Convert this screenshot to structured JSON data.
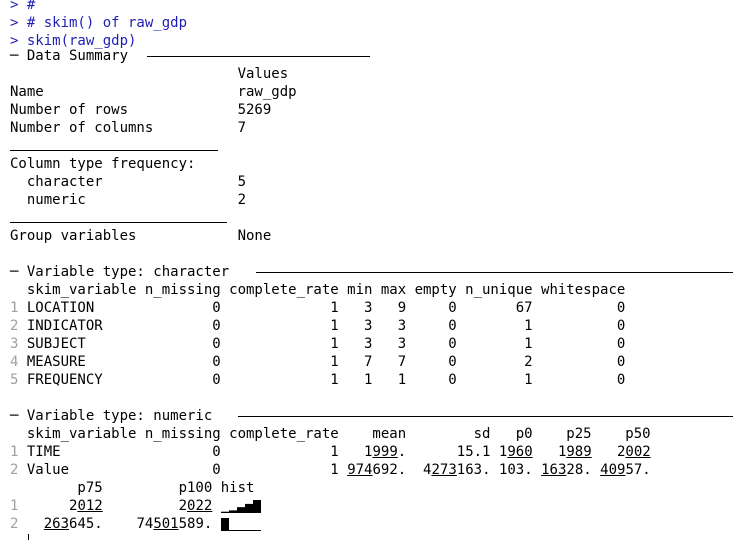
{
  "console": {
    "prompt": ">",
    "commands": [
      "#",
      "# skim() of raw_gdp",
      "skim(raw_gdp)"
    ]
  },
  "data_summary": {
    "header": "Data Summary",
    "values_header": "Values",
    "rows": [
      {
        "label": "Name",
        "value": "raw_gdp"
      },
      {
        "label": "Number of rows",
        "value": "5269"
      },
      {
        "label": "Number of columns",
        "value": "7"
      }
    ],
    "column_type_header": "Column type frequency:",
    "column_types": [
      {
        "label": "character",
        "value": "5"
      },
      {
        "label": "numeric",
        "value": "2"
      }
    ],
    "group_label": "Group variables",
    "group_value": "None"
  },
  "character_section": {
    "header": "Variable type: character",
    "columns": [
      "skim_variable",
      "n_missing",
      "complete_rate",
      "min",
      "max",
      "empty",
      "n_unique",
      "whitespace"
    ],
    "rows": [
      {
        "no": "1",
        "cells": [
          "LOCATION",
          "0",
          "1",
          "3",
          "9",
          "0",
          "67",
          "0"
        ]
      },
      {
        "no": "2",
        "cells": [
          "INDICATOR",
          "0",
          "1",
          "3",
          "3",
          "0",
          "1",
          "0"
        ]
      },
      {
        "no": "3",
        "cells": [
          "SUBJECT",
          "0",
          "1",
          "3",
          "3",
          "0",
          "1",
          "0"
        ]
      },
      {
        "no": "4",
        "cells": [
          "MEASURE",
          "0",
          "1",
          "7",
          "7",
          "0",
          "2",
          "0"
        ]
      },
      {
        "no": "5",
        "cells": [
          "FREQUENCY",
          "0",
          "1",
          "1",
          "1",
          "0",
          "1",
          "0"
        ]
      }
    ]
  },
  "numeric_section": {
    "header": "Variable type: numeric",
    "columns": [
      "skim_variable",
      "n_missing",
      "complete_rate",
      "mean",
      "sd",
      "p0",
      "p25",
      "p50"
    ],
    "rows": [
      {
        "no": "1",
        "cells": [
          "TIME",
          "0",
          "1",
          "1999.",
          "15.1",
          "1960",
          "1989",
          "2002"
        ]
      },
      {
        "no": "2",
        "cells": [
          "Value",
          "0",
          "1",
          "974692.",
          "4273163.",
          "103.",
          "16328.",
          "40957."
        ]
      }
    ],
    "columns2": [
      "p75",
      "p100",
      "hist"
    ],
    "rows2": [
      {
        "no": "1",
        "cells": [
          "2012",
          "2022"
        ],
        "hist": [
          0.1,
          0.2,
          0.45,
          0.7,
          1.0
        ]
      },
      {
        "no": "2",
        "cells": [
          "263645.",
          "74501589."
        ],
        "hist": [
          1.0,
          0.05,
          0.05,
          0.05,
          0.05
        ]
      }
    ]
  }
}
